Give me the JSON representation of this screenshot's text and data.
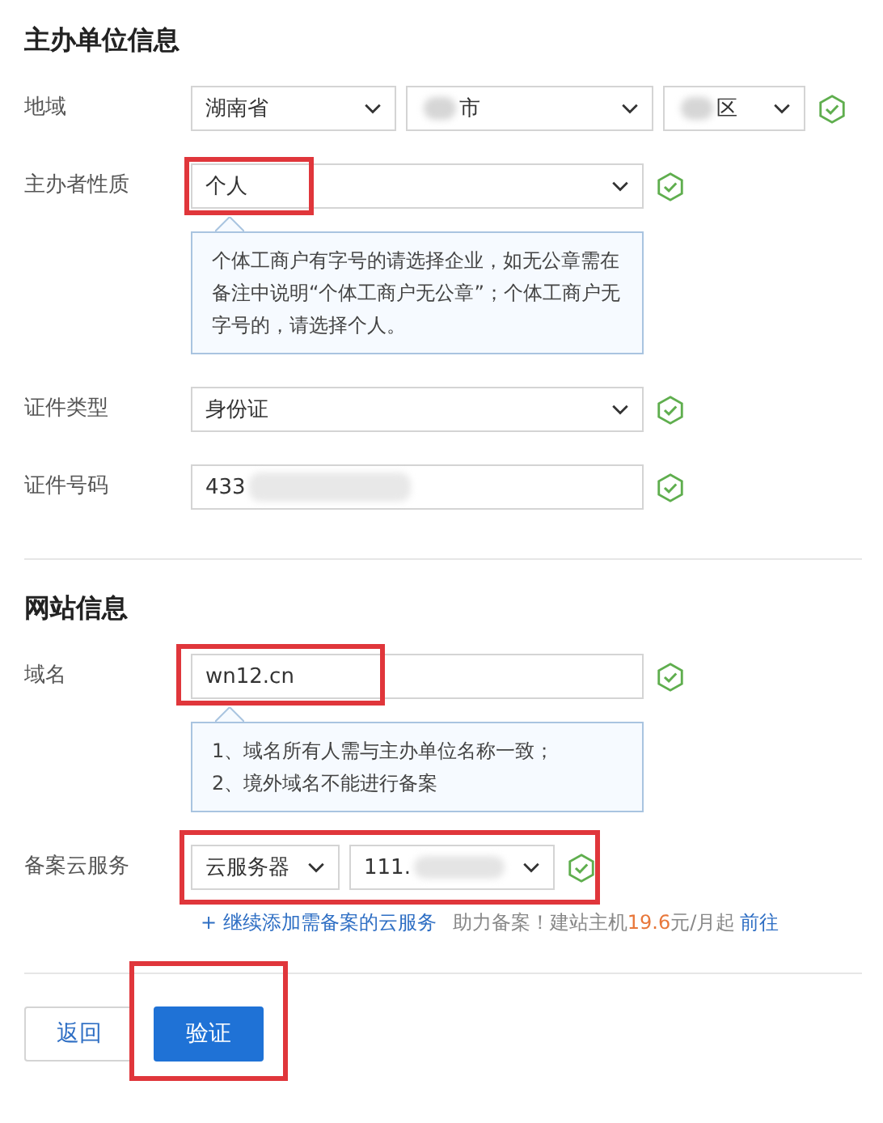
{
  "sections": [
    {
      "title": "主办单位信息",
      "fields": [
        {
          "kind": "selects",
          "label": "地域",
          "valid": true,
          "annotated": false,
          "selects": [
            {
              "value": "湖南省"
            },
            {
              "value": "市",
              "blurred_before": true
            },
            {
              "value": "区",
              "blurred_before": true
            }
          ]
        },
        {
          "kind": "select",
          "label": "主办者性质",
          "valid": true,
          "annotated": true,
          "value": "个人",
          "tip": [
            "个体工商户有字号的请选择企业，如无公章需在备注中说明“个体工商户无公章”；个体工商户无字号的，请选择个人。"
          ]
        },
        {
          "kind": "select",
          "label": "证件类型",
          "valid": true,
          "annotated": false,
          "value": "身份证"
        },
        {
          "kind": "input",
          "label": "证件号码",
          "valid": true,
          "annotated": false,
          "value": "433",
          "blurred_after": true
        }
      ]
    },
    {
      "title": "网站信息",
      "fields": [
        {
          "kind": "input",
          "label": "域名",
          "valid": true,
          "annotated": true,
          "value": "wn12.cn",
          "tip": [
            "1、域名所有人需与主办单位名称一致；",
            "2、境外域名不能进行备案"
          ]
        },
        {
          "kind": "selects",
          "label": "备案云服务",
          "valid": true,
          "annotated": true,
          "selects": [
            {
              "value": "云服务器"
            },
            {
              "value": "111.",
              "blurred_after": true
            }
          ],
          "links": {
            "add": "+ 继续添加需备案的云服务",
            "promo": "助力备案！建站主机",
            "price": "19.6",
            "unit": "元/月起",
            "go": "前往"
          }
        }
      ]
    }
  ],
  "buttons": [
    {
      "label": "返回",
      "primary": false,
      "annotated": false
    },
    {
      "label": "验证",
      "primary": true,
      "annotated": true
    }
  ]
}
